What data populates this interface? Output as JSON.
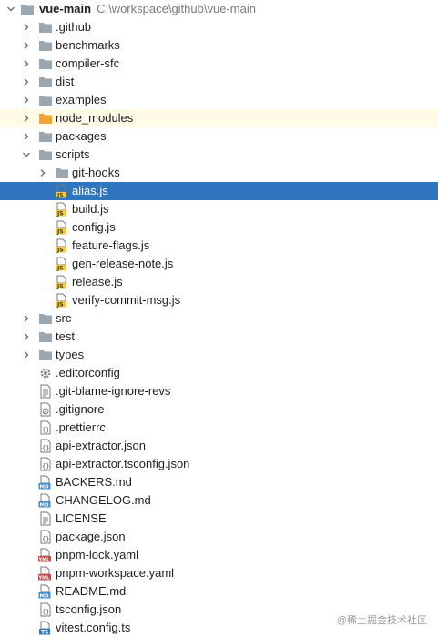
{
  "project": {
    "name": "vue-main",
    "path": "C:\\workspace\\github\\vue-main"
  },
  "tree": [
    {
      "label": ".github",
      "type": "folder",
      "depth": 1,
      "expanded": false,
      "name": "folder-github"
    },
    {
      "label": "benchmarks",
      "type": "folder",
      "depth": 1,
      "expanded": false,
      "name": "folder-benchmarks"
    },
    {
      "label": "compiler-sfc",
      "type": "folder",
      "depth": 1,
      "expanded": false,
      "name": "folder-compiler-sfc"
    },
    {
      "label": "dist",
      "type": "folder",
      "depth": 1,
      "expanded": false,
      "name": "folder-dist"
    },
    {
      "label": "examples",
      "type": "folder",
      "depth": 1,
      "expanded": false,
      "name": "folder-examples"
    },
    {
      "label": "node_modules",
      "type": "folder-orange",
      "depth": 1,
      "expanded": false,
      "highlight": true,
      "name": "folder-node-modules"
    },
    {
      "label": "packages",
      "type": "folder",
      "depth": 1,
      "expanded": false,
      "name": "folder-packages"
    },
    {
      "label": "scripts",
      "type": "folder",
      "depth": 1,
      "expanded": true,
      "name": "folder-scripts"
    },
    {
      "label": "git-hooks",
      "type": "folder",
      "depth": 2,
      "expanded": false,
      "name": "folder-git-hooks"
    },
    {
      "label": "alias.js",
      "type": "js",
      "depth": 2,
      "selected": true,
      "name": "file-alias-js"
    },
    {
      "label": "build.js",
      "type": "js",
      "depth": 2,
      "name": "file-build-js"
    },
    {
      "label": "config.js",
      "type": "js",
      "depth": 2,
      "name": "file-config-js"
    },
    {
      "label": "feature-flags.js",
      "type": "js",
      "depth": 2,
      "name": "file-feature-flags-js"
    },
    {
      "label": "gen-release-note.js",
      "type": "js",
      "depth": 2,
      "name": "file-gen-release-note-js"
    },
    {
      "label": "release.js",
      "type": "js",
      "depth": 2,
      "name": "file-release-js"
    },
    {
      "label": "verify-commit-msg.js",
      "type": "js",
      "depth": 2,
      "name": "file-verify-commit-msg-js"
    },
    {
      "label": "src",
      "type": "folder",
      "depth": 1,
      "expanded": false,
      "name": "folder-src"
    },
    {
      "label": "test",
      "type": "folder",
      "depth": 1,
      "expanded": false,
      "name": "folder-test"
    },
    {
      "label": "types",
      "type": "folder",
      "depth": 1,
      "expanded": false,
      "name": "folder-types"
    },
    {
      "label": ".editorconfig",
      "type": "gear",
      "depth": 1,
      "name": "file-editorconfig"
    },
    {
      "label": ".git-blame-ignore-revs",
      "type": "text",
      "depth": 1,
      "name": "file-git-blame-ignore-revs"
    },
    {
      "label": ".gitignore",
      "type": "ignore",
      "depth": 1,
      "name": "file-gitignore"
    },
    {
      "label": ".prettierrc",
      "type": "json",
      "depth": 1,
      "name": "file-prettierrc"
    },
    {
      "label": "api-extractor.json",
      "type": "json",
      "depth": 1,
      "name": "file-api-extractor-json"
    },
    {
      "label": "api-extractor.tsconfig.json",
      "type": "json",
      "depth": 1,
      "name": "file-api-extractor-tsconfig-json"
    },
    {
      "label": "BACKERS.md",
      "type": "md",
      "depth": 1,
      "name": "file-backers-md"
    },
    {
      "label": "CHANGELOG.md",
      "type": "md",
      "depth": 1,
      "name": "file-changelog-md"
    },
    {
      "label": "LICENSE",
      "type": "text",
      "depth": 1,
      "name": "file-license"
    },
    {
      "label": "package.json",
      "type": "json",
      "depth": 1,
      "name": "file-package-json"
    },
    {
      "label": "pnpm-lock.yaml",
      "type": "yaml",
      "depth": 1,
      "name": "file-pnpm-lock-yaml"
    },
    {
      "label": "pnpm-workspace.yaml",
      "type": "yaml",
      "depth": 1,
      "name": "file-pnpm-workspace-yaml"
    },
    {
      "label": "README.md",
      "type": "md",
      "depth": 1,
      "name": "file-readme-md"
    },
    {
      "label": "tsconfig.json",
      "type": "json",
      "depth": 1,
      "name": "file-tsconfig-json"
    },
    {
      "label": "vitest.config.ts",
      "type": "ts",
      "depth": 1,
      "name": "file-vitest-config-ts"
    }
  ],
  "watermark": "@稀土掘金技术社区",
  "colors": {
    "selection": "#2f75c0",
    "highlight": "#fffbe6",
    "folder": "#9aa7b0",
    "folder_orange": "#f3a233",
    "js_badge": "#f2c94c",
    "md_badge": "#3d8fd1",
    "yaml_badge": "#c94a4a",
    "ts_badge": "#3178c6"
  }
}
